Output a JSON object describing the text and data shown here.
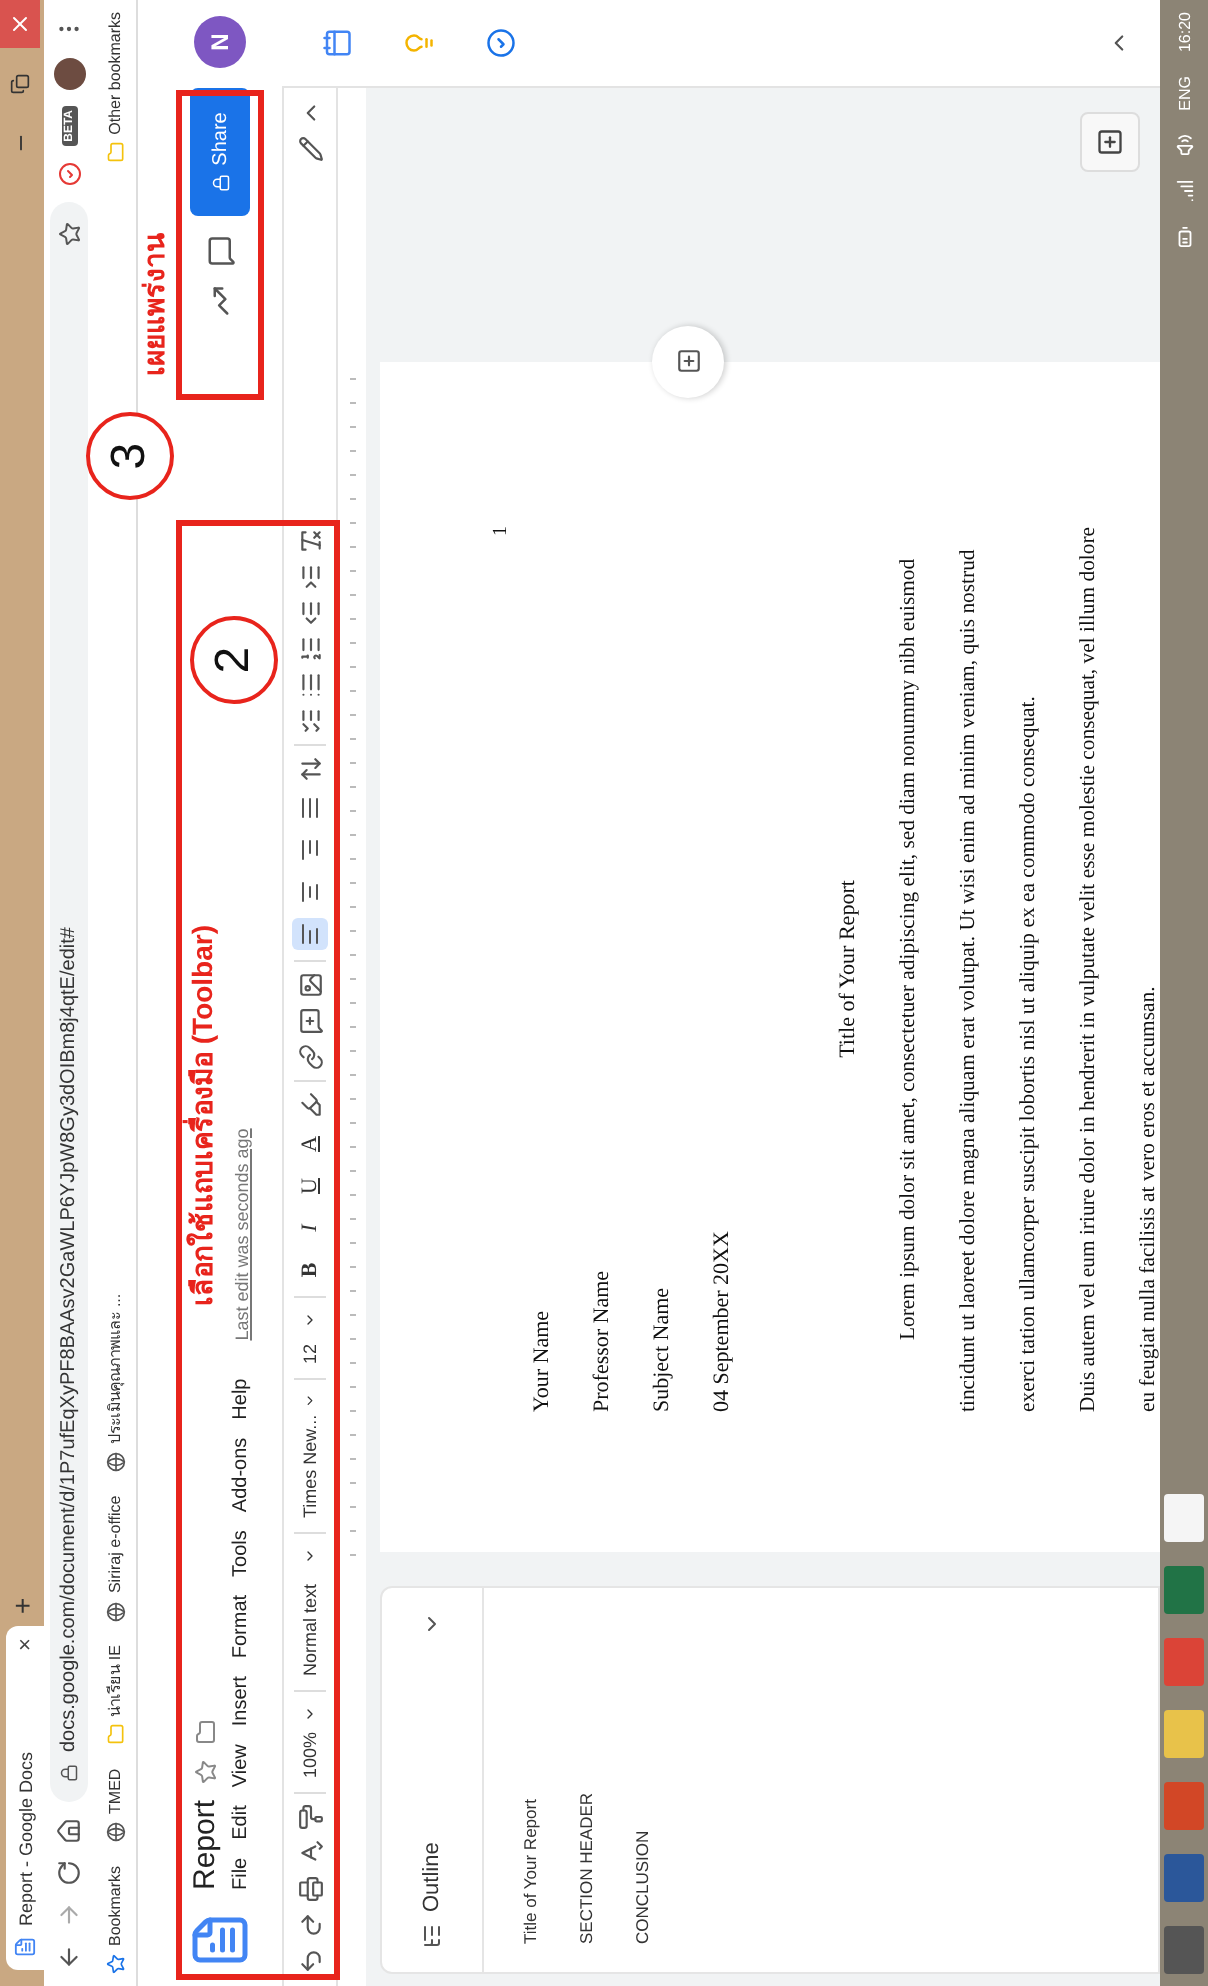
{
  "browser": {
    "tab": {
      "title": "Report - Google Docs",
      "close": "×"
    },
    "new_tab": "+",
    "url": "docs.google.com/document/d/1P7ufEqXyPF8BAAsv2GaWLP6YJpW8Gy3dOIBm8j4qtE/edit#",
    "extension_badge": "BETA",
    "bookmarks": [
      {
        "kind": "star",
        "label": "Bookmarks"
      },
      {
        "kind": "globe",
        "label": "TMED"
      },
      {
        "kind": "folder",
        "label": "น่าเรียน IE"
      },
      {
        "kind": "globe",
        "label": "Siriraj e-office"
      },
      {
        "kind": "globe",
        "label": "ประเมินคุณภาพและ ..."
      }
    ],
    "other_bookmarks": "Other bookmarks"
  },
  "doc": {
    "title": "Report",
    "menu": [
      "File",
      "Edit",
      "View",
      "Insert",
      "Format",
      "Tools",
      "Add-ons",
      "Help"
    ],
    "last_edit": "Last edit was seconds ago",
    "share": "Share",
    "avatar": "N"
  },
  "toolbar": {
    "zoom": "100%",
    "style": "Normal text",
    "font": "Times New...",
    "size": "12",
    "format_buttons": [
      {
        "label": "B"
      },
      {
        "label": "I"
      },
      {
        "label": "U"
      },
      {
        "label": "A"
      }
    ],
    "alignments": [
      {
        "selected": true
      },
      {
        "selected": false
      },
      {
        "selected": false
      },
      {
        "selected": false
      }
    ]
  },
  "outline": {
    "title": "Outline",
    "items": [
      "Title of Your Report",
      "SECTION HEADER",
      "CONCLUSION"
    ]
  },
  "page": {
    "number": "1",
    "header_lines": [
      "Your Name",
      "Professor Name",
      "Subject Name",
      "04 September 20XX"
    ],
    "title": "Title of Your Report",
    "paragraphs": [
      {
        "indent": true,
        "text": "Lorem ipsum dolor sit amet, consectetuer adipiscing elit, sed diam nonummy nibh euismod tincidunt ut laoreet dolore magna aliquam erat volutpat. Ut wisi enim ad minim veniam, quis nostrud exerci tation ullamcorper suscipit lobortis nisl ut aliquip ex ea commodo consequat."
      },
      {
        "indent": false,
        "text": "Duis autem vel eum iriure dolor in hendrerit in vulputate velit esse molestie consequat, vel illum dolore eu feugiat nulla facilisis at vero eros et accumsan."
      }
    ]
  },
  "taskbar": {
    "language": "ENG",
    "time": "16:20"
  },
  "annotations": [
    {
      "number": "2",
      "caption": "เลือกใช้แถบเครื่องมือ (Toolbar)"
    },
    {
      "number": "3",
      "caption": "เผยแพร่งาน"
    }
  ]
}
